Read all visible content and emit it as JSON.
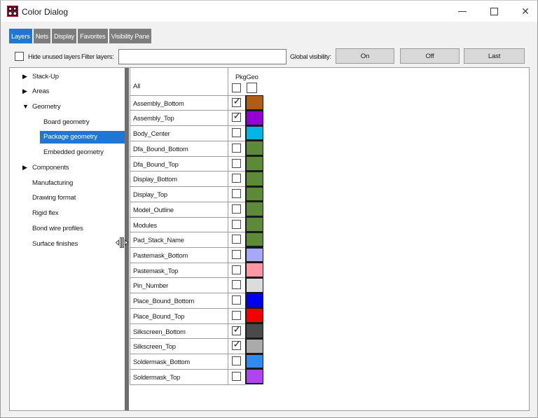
{
  "window": {
    "title": "Color Dialog"
  },
  "titlebar": {
    "close_glyph": "✕"
  },
  "accent_color": "#2176d4",
  "tabs": [
    {
      "label": "Layers",
      "active": true
    },
    {
      "label": "Nets",
      "active": false
    },
    {
      "label": "Display",
      "active": false
    },
    {
      "label": "Favorites",
      "active": false
    },
    {
      "label": "Visibility Pane",
      "active": false
    }
  ],
  "toolbar": {
    "hide_unused_label": "Hide unused layers",
    "hide_unused_checked": false,
    "filter_label": "Filter layers:",
    "filter_value": "",
    "global_label": "Global visibility:",
    "buttons": [
      "On",
      "Off",
      "Last"
    ]
  },
  "tree": {
    "items": [
      {
        "label": "Stack-Up",
        "type": "collapsed"
      },
      {
        "label": "Areas",
        "type": "collapsed"
      },
      {
        "label": "Geometry",
        "type": "expanded"
      },
      {
        "label": "Board geometry",
        "type": "child"
      },
      {
        "label": "Package geometry",
        "type": "child",
        "selected": true
      },
      {
        "label": "Embedded geometry",
        "type": "child"
      },
      {
        "label": "Components",
        "type": "collapsed"
      },
      {
        "label": "Manufacturing",
        "type": "leaf"
      },
      {
        "label": "Drawing format",
        "type": "leaf"
      },
      {
        "label": "Rigid flex",
        "type": "leaf"
      },
      {
        "label": "Bond wire profiles",
        "type": "leaf"
      },
      {
        "label": "Surface finishes",
        "type": "leaf"
      }
    ]
  },
  "table": {
    "group_header": "PkgGeo",
    "all_label": "All",
    "rows": [
      {
        "name": "Assembly_Bottom",
        "checked": true,
        "color": "#b05c14"
      },
      {
        "name": "Assembly_Top",
        "checked": true,
        "color": "#9400d3"
      },
      {
        "name": "Body_Center",
        "checked": false,
        "color": "#00b4e6"
      },
      {
        "name": "Dfa_Bound_Bottom",
        "checked": false,
        "color": "#5c8a38"
      },
      {
        "name": "Dfa_Bound_Top",
        "checked": false,
        "color": "#5c8a38"
      },
      {
        "name": "Display_Bottom",
        "checked": false,
        "color": "#5c8a38"
      },
      {
        "name": "Display_Top",
        "checked": false,
        "color": "#5c8a38"
      },
      {
        "name": "Model_Outline",
        "checked": false,
        "color": "#5c8a38"
      },
      {
        "name": "Modules",
        "checked": false,
        "color": "#5c8a38"
      },
      {
        "name": "Pad_Stack_Name",
        "checked": false,
        "color": "#5c8a38"
      },
      {
        "name": "Pastemask_Bottom",
        "checked": false,
        "color": "#a8a8f8"
      },
      {
        "name": "Pastemask_Top",
        "checked": false,
        "color": "#ff96a4"
      },
      {
        "name": "Pin_Number",
        "checked": false,
        "color": "#dcdcdc"
      },
      {
        "name": "Place_Bound_Bottom",
        "checked": false,
        "color": "#0000f0"
      },
      {
        "name": "Place_Bound_Top",
        "checked": false,
        "color": "#f40000"
      },
      {
        "name": "Silkscreen_Bottom",
        "checked": true,
        "color": "#4a4a4a"
      },
      {
        "name": "Silkscreen_Top",
        "checked": true,
        "color": "#aaaaaa"
      },
      {
        "name": "Soldermask_Bottom",
        "checked": false,
        "color": "#2e8cf0"
      },
      {
        "name": "Soldermask_Top",
        "checked": false,
        "color": "#b044f0"
      }
    ]
  }
}
